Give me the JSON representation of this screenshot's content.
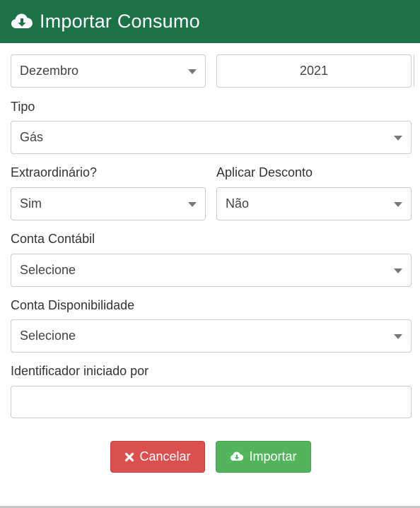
{
  "header": {
    "title": "Importar Consumo",
    "icon": "cloud-download-icon"
  },
  "period": {
    "month": "Dezembro",
    "year": "2021"
  },
  "tipo": {
    "label": "Tipo",
    "value": "Gás"
  },
  "extraordinario": {
    "label": "Extraordinário?",
    "value": "Sim"
  },
  "desconto": {
    "label": "Aplicar Desconto",
    "value": "Não"
  },
  "conta_contabil": {
    "label": "Conta Contábil",
    "value": "Selecione"
  },
  "conta_disponibilidade": {
    "label": "Conta Disponibilidade",
    "value": "Selecione"
  },
  "identificador": {
    "label": "Identificador iniciado por",
    "value": ""
  },
  "buttons": {
    "cancel": {
      "label": "Cancelar",
      "icon": "close-icon",
      "color": "#dc4f4f"
    },
    "import": {
      "label": "Importar",
      "icon": "cloud-download-icon",
      "color": "#52b55c"
    }
  },
  "colors": {
    "header": "#1b7347"
  }
}
